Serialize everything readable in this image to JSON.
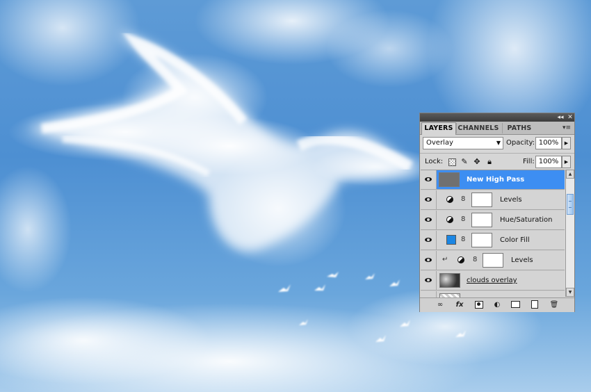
{
  "panel": {
    "title_controls": {
      "collapse": "◂◂",
      "close": "✕"
    },
    "tabs": [
      {
        "label": "LAYERS",
        "active": true
      },
      {
        "label": "CHANNELS",
        "active": false
      },
      {
        "label": "PATHS",
        "active": false
      }
    ],
    "menu_icon": "▾≡",
    "blend_mode": "Overlay",
    "blend_arrow": "▼",
    "opacity_label": "Opacity:",
    "opacity_value": "100%",
    "lock_label": "Lock:",
    "lock_icons": [
      "lock-transparent-icon",
      "lock-image-icon",
      "lock-position-icon",
      "lock-all-icon"
    ],
    "lock_glyphs": {
      "image": "✎",
      "position": "✥",
      "all": "🔒︎"
    },
    "fill_label": "Fill:",
    "fill_value": "100%",
    "stepper_glyph": "▶",
    "layers": [
      {
        "name": "New High Pass",
        "selected": true
      },
      {
        "name": "Levels"
      },
      {
        "name": "Hue/Saturation"
      },
      {
        "name": "Color Fill"
      },
      {
        "name": "Levels"
      },
      {
        "name": "clouds overlay"
      }
    ],
    "bottom_icons": [
      "link-layers-icon",
      "fx-icon",
      "add-mask-icon",
      "adjustment-layer-icon",
      "new-group-icon",
      "new-layer-icon",
      "trash-icon"
    ],
    "bottom_glyphs": {
      "link": "∞",
      "fx": "fx",
      "adj": "◐",
      "trash": "🗑︎"
    },
    "scroll_glyphs": {
      "up": "▲",
      "down": "▼"
    },
    "chain_glyph": "8",
    "clip_glyph": "↵",
    "colors": {
      "selection": "#3d8ef2",
      "color_fill_swatch": "#1b86e3"
    }
  }
}
